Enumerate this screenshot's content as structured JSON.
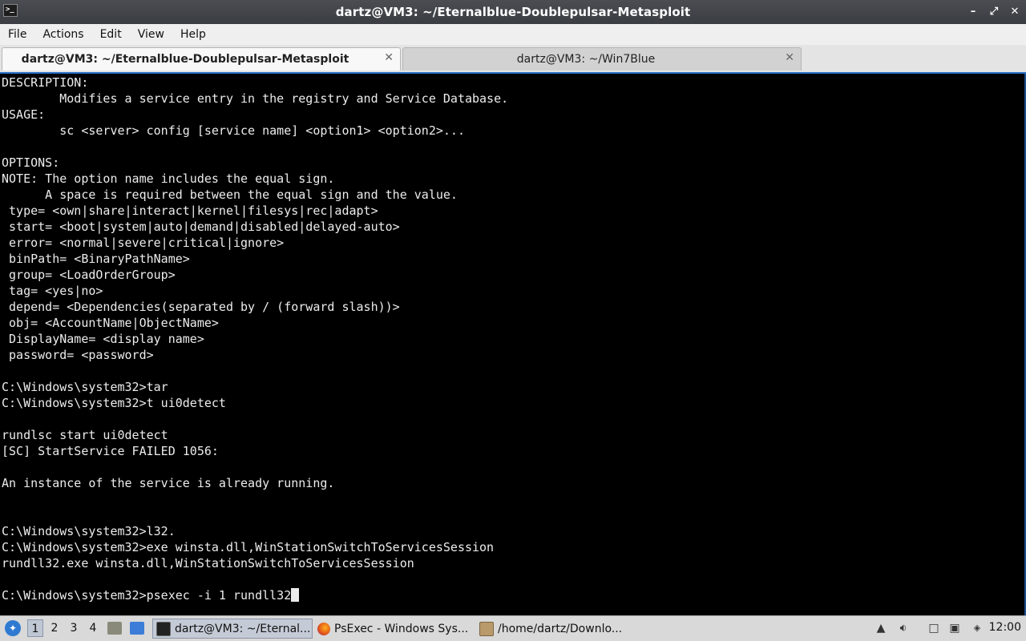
{
  "window": {
    "title": "dartz@VM3: ~/Eternalblue-Doublepulsar-Metasploit",
    "icon": "terminal-icon"
  },
  "menubar": [
    "File",
    "Actions",
    "Edit",
    "View",
    "Help"
  ],
  "tabs": [
    {
      "label": "dartz@VM3: ~/Eternalblue-Doublepulsar-Metasploit",
      "active": true
    },
    {
      "label": "dartz@VM3: ~/Win7Blue",
      "active": false
    }
  ],
  "terminal": {
    "lines": [
      "DESCRIPTION:",
      "        Modifies a service entry in the registry and Service Database.",
      "USAGE:",
      "        sc <server> config [service name] <option1> <option2>...",
      "",
      "OPTIONS:",
      "NOTE: The option name includes the equal sign.",
      "      A space is required between the equal sign and the value.",
      " type= <own|share|interact|kernel|filesys|rec|adapt>",
      " start= <boot|system|auto|demand|disabled|delayed-auto>",
      " error= <normal|severe|critical|ignore>",
      " binPath= <BinaryPathName>",
      " group= <LoadOrderGroup>",
      " tag= <yes|no>",
      " depend= <Dependencies(separated by / (forward slash))>",
      " obj= <AccountName|ObjectName>",
      " DisplayName= <display name>",
      " password= <password>",
      "",
      "C:\\Windows\\system32>tar",
      "C:\\Windows\\system32>t ui0detect",
      "",
      "rundlsc start ui0detect",
      "[SC] StartService FAILED 1056:",
      "",
      "An instance of the service is already running.",
      "",
      "",
      "C:\\Windows\\system32>l32.",
      "C:\\Windows\\system32>exe winsta.dll,WinStationSwitchToServicesSession",
      "rundll32.exe winsta.dll,WinStationSwitchToServicesSession",
      "",
      "C:\\Windows\\system32>psexec -i 1 rundll32"
    ],
    "colors": {
      "background": "#000000",
      "foreground": "#ececec",
      "accent": "#2a6fc9"
    }
  },
  "taskbar": {
    "workspaces": [
      "1",
      "2",
      "3",
      "4"
    ],
    "active_workspace": "1",
    "tasks": [
      {
        "label": "dartz@VM3: ~/Eternal...",
        "icon": "terminal-icon",
        "active": true
      },
      {
        "label": "PsExec - Windows Sys...",
        "icon": "firefox-icon",
        "active": false
      },
      {
        "label": "/home/dartz/Downlo...",
        "icon": "archive-icon",
        "active": false
      }
    ],
    "clock": "12:00"
  }
}
